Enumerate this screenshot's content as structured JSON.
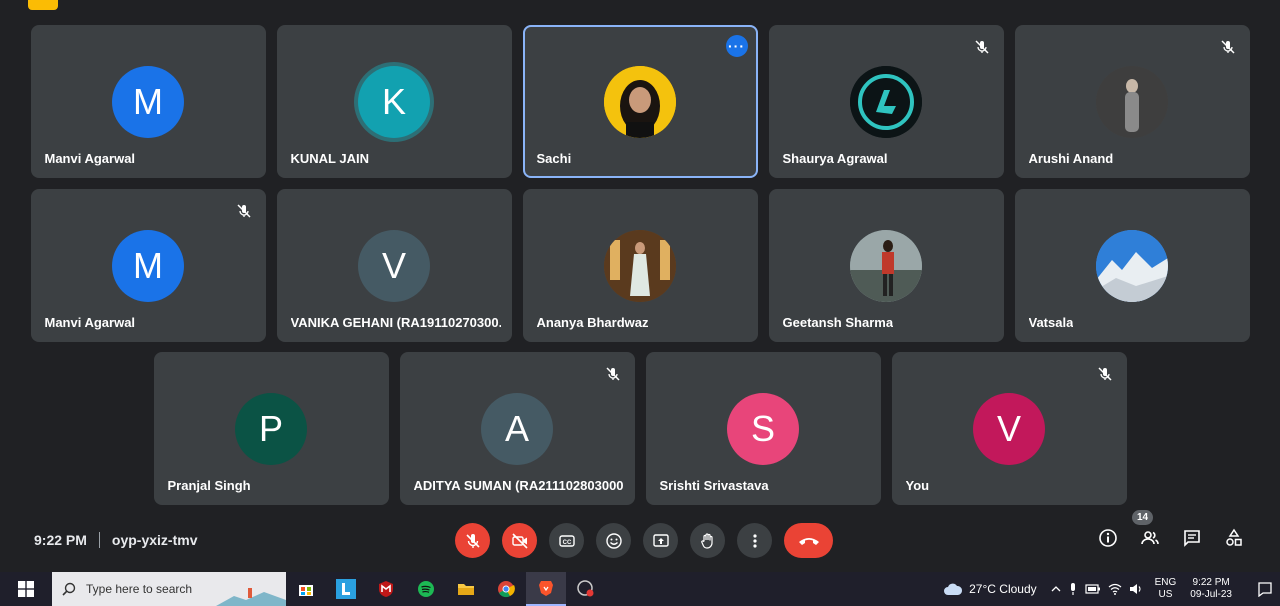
{
  "participants": [
    {
      "name": "Manvi Agarwal",
      "initial": "M",
      "color": "#1a73e8",
      "muted": false
    },
    {
      "name": "KUNAL JAIN",
      "initial": "K",
      "color": "#12a1b0",
      "muted": false
    },
    {
      "name": "Sachi",
      "initial": "",
      "color": "#f4b400",
      "muted": false,
      "active": true
    },
    {
      "name": "Shaurya Agrawal",
      "initial": "",
      "color": "#1b2b2d",
      "muted": true
    },
    {
      "name": "Arushi Anand",
      "initial": "",
      "color": "#5a5a5a",
      "muted": true
    },
    {
      "name": "Manvi Agarwal",
      "initial": "M",
      "color": "#1a73e8",
      "muted": true
    },
    {
      "name": "VANIKA GEHANI (RA19110270300...",
      "initial": "V",
      "color": "#455a64",
      "muted": false
    },
    {
      "name": "Ananya Bhardwaz",
      "initial": "",
      "color": "#6d4c2f",
      "muted": false
    },
    {
      "name": "Geetansh Sharma",
      "initial": "",
      "color": "#6b7b7f",
      "muted": false
    },
    {
      "name": "Vatsala",
      "initial": "",
      "color": "#4c8fd6",
      "muted": false
    },
    {
      "name": "Pranjal Singh",
      "initial": "P",
      "color": "#0b5345",
      "muted": false
    },
    {
      "name": "ADITYA SUMAN (RA211102803000...",
      "initial": "A",
      "color": "#455a64",
      "muted": true
    },
    {
      "name": "Srishti Srivastava",
      "initial": "S",
      "color": "#e8457a",
      "muted": false
    },
    {
      "name": "You",
      "initial": "V",
      "color": "#c2185b",
      "muted": true
    }
  ],
  "meeting": {
    "time": "9:22 PM",
    "code": "oyp-yxiz-tmv",
    "participant_count": "14"
  },
  "taskbar": {
    "search_placeholder": "Type here to search",
    "weather": "27°C  Cloudy",
    "lang_top": "ENG",
    "lang_bottom": "US",
    "clock_time": "9:22 PM",
    "clock_date": "09-Jul-23"
  },
  "colors": {
    "accent": "#8ab4f8",
    "danger": "#ea4335",
    "tile": "#3c4043",
    "background": "#202124"
  }
}
